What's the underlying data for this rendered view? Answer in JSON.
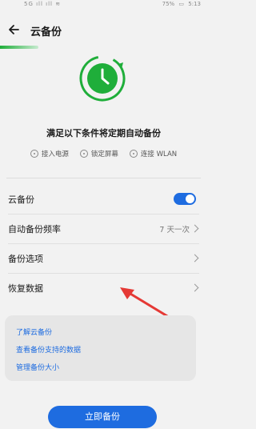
{
  "status_bar": {
    "left": "5G ıll ıll ≋",
    "battery": "75%",
    "time": "5:13"
  },
  "header": {
    "title": "云备份"
  },
  "hero": {
    "title": "满足以下条件将定期自动备份",
    "conditions": [
      "接入电源",
      "锁定屏幕",
      "连接 WLAN"
    ]
  },
  "settings": {
    "cloud_backup_label": "云备份",
    "cloud_backup_on": true,
    "frequency_label": "自动备份频率",
    "frequency_value": "7 天一次",
    "options_label": "备份选项",
    "restore_label": "恢复数据"
  },
  "info": {
    "links": [
      "了解云备份",
      "查看备份支持的数据",
      "管理备份大小"
    ]
  },
  "cta": {
    "label": "立即备份"
  },
  "colors": {
    "accent": "#1e6ce0",
    "green": "#1fae3a",
    "annotation": "#e53935"
  }
}
